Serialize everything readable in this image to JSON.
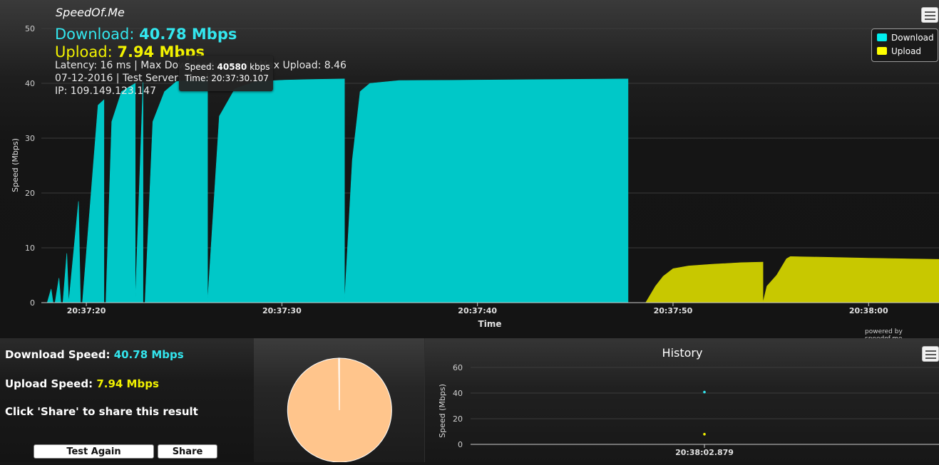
{
  "brand": "SpeedOf.Me",
  "summary": {
    "download_label": "Download:",
    "download_value": "40.78 Mbps",
    "upload_label": "Upload:",
    "upload_value": "7.94 Mbps",
    "latency_line": "Latency: 16 ms | Max Download: 40.78 | Max Upload: 8.46",
    "date_line": "07-12-2016 | Test Server: Frankfurt",
    "ip_line": "IP: 109.149.123.147"
  },
  "tooltip": {
    "speed_label": "Speed:",
    "speed_value": "40580",
    "speed_unit": "kbps",
    "time_label": "Time:",
    "time_value": "20:37:30.107"
  },
  "legend": {
    "download": "Download",
    "upload": "Upload"
  },
  "powered_by": "powered by speedof.me",
  "colors": {
    "download": "#00c8c8",
    "upload": "#c8c800",
    "download_text": "#33e6ee",
    "upload_text": "#f2f200",
    "pie": "#ffc58c"
  },
  "chart_data": [
    {
      "type": "area",
      "xlabel": "Time",
      "ylabel": "Speed (Mbps)",
      "ylim": [
        0,
        50
      ],
      "yticks": [
        0,
        10,
        20,
        30,
        40,
        50
      ],
      "xticks": [
        "20:37:20",
        "20:37:30",
        "20:37:40",
        "20:37:50",
        "20:38:00"
      ],
      "xtick_seconds": [
        20,
        30,
        40,
        50,
        60
      ],
      "xlim": [
        17.7,
        63.6
      ],
      "legend_position": "top-right",
      "grid": true,
      "series": [
        {
          "name": "Download",
          "color": "#00c8c8",
          "points": [
            [
              18.0,
              0
            ],
            [
              18.2,
              2.5
            ],
            [
              18.3,
              0
            ],
            [
              18.4,
              0
            ],
            [
              18.6,
              4.5
            ],
            [
              18.7,
              0
            ],
            [
              18.8,
              0
            ],
            [
              19.0,
              9.0
            ],
            [
              19.1,
              0
            ],
            [
              19.1,
              0
            ],
            [
              19.6,
              18.5
            ],
            [
              19.7,
              0
            ],
            [
              19.8,
              0
            ],
            [
              20.6,
              36.0
            ],
            [
              20.9,
              37.0
            ],
            [
              20.9,
              0
            ],
            [
              21.0,
              0
            ],
            [
              21.3,
              33.0
            ],
            [
              21.8,
              38.5
            ],
            [
              22.5,
              40.0
            ],
            [
              22.5,
              0
            ],
            [
              22.5,
              0
            ],
            [
              22.9,
              40.2
            ],
            [
              22.9,
              0
            ],
            [
              23.0,
              0
            ],
            [
              23.4,
              33.0
            ],
            [
              24.0,
              38.5
            ],
            [
              24.6,
              40.3
            ],
            [
              25.4,
              40.7
            ],
            [
              26.2,
              40.8
            ],
            [
              26.2,
              0
            ],
            [
              26.2,
              0
            ],
            [
              26.8,
              34.0
            ],
            [
              27.6,
              39.0
            ],
            [
              28.6,
              40.3
            ],
            [
              30.1,
              40.58
            ],
            [
              31.5,
              40.7
            ],
            [
              33.2,
              40.8
            ],
            [
              33.2,
              0
            ],
            [
              33.2,
              0
            ],
            [
              33.6,
              26.0
            ],
            [
              34.0,
              38.5
            ],
            [
              34.5,
              40.0
            ],
            [
              36.0,
              40.5
            ],
            [
              40.0,
              40.6
            ],
            [
              44.0,
              40.7
            ],
            [
              47.7,
              40.8
            ],
            [
              47.7,
              0
            ]
          ]
        },
        {
          "name": "Upload",
          "color": "#c8c800",
          "points": [
            [
              48.6,
              0
            ],
            [
              49.1,
              3.0
            ],
            [
              49.5,
              4.8
            ],
            [
              50.0,
              6.2
            ],
            [
              50.8,
              6.7
            ],
            [
              52.0,
              7.0
            ],
            [
              53.5,
              7.3
            ],
            [
              54.6,
              7.4
            ],
            [
              54.6,
              0
            ],
            [
              54.6,
              0
            ],
            [
              54.8,
              3.0
            ],
            [
              55.3,
              5.0
            ],
            [
              55.8,
              8.0
            ],
            [
              56.0,
              8.4
            ],
            [
              57.5,
              8.3
            ],
            [
              60.0,
              8.1
            ],
            [
              63.6,
              7.9
            ],
            [
              63.6,
              0
            ]
          ]
        }
      ]
    },
    {
      "type": "pie",
      "slices": [
        {
          "value": 99.8,
          "color": "#ffc58c"
        },
        {
          "value": 0.2,
          "color": "#ffffff"
        }
      ]
    },
    {
      "type": "scatter",
      "title": "History",
      "ylabel": "Speed (Mbps)",
      "ylim": [
        0,
        60
      ],
      "yticks": [
        0,
        20,
        40,
        60
      ],
      "xticks": [
        "20:38:02.879"
      ],
      "grid": true,
      "series": [
        {
          "name": "Download",
          "color": "#33e6ee",
          "values": [
            40.78
          ]
        },
        {
          "name": "Upload",
          "color": "#f2f200",
          "values": [
            7.94
          ]
        }
      ]
    }
  ],
  "bottom": {
    "dl_label": "Download Speed:",
    "dl_value": "40.78 Mbps",
    "ul_label": "Upload Speed:",
    "ul_value": "7.94 Mbps",
    "share_hint": "Click 'Share' to share this result",
    "test_again": "Test Again",
    "share": "Share"
  },
  "icons": {
    "chart_menu": "hamburger-menu-icon",
    "history_menu": "hamburger-menu-icon"
  }
}
